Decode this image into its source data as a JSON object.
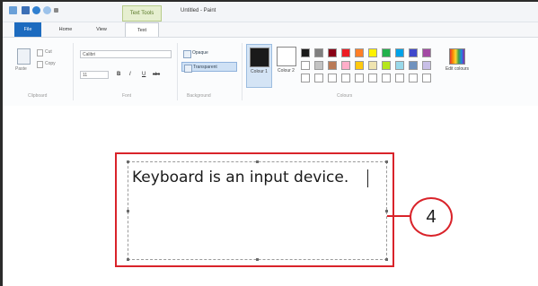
{
  "window": {
    "context_tab_label": "Text Tools",
    "title": "Untitled - Paint"
  },
  "tabs": [
    {
      "label": "File"
    },
    {
      "label": "Home"
    },
    {
      "label": "View"
    },
    {
      "label": "Text"
    }
  ],
  "ribbon": {
    "clipboard": {
      "paste_label": "Paste",
      "cut_label": "Cut",
      "copy_label": "Copy",
      "group_label": "Clipboard"
    },
    "font": {
      "family_value": "Calibri",
      "size_value": "11",
      "bold": "B",
      "italic": "I",
      "underline": "U",
      "strikethrough": "abc",
      "group_label": "Font"
    },
    "background": {
      "opaque_label": "Opaque",
      "transparent_label": "Transparent",
      "group_label": "Background"
    },
    "colors": {
      "color1_label": "Colour 1",
      "color2_label": "Colour 2",
      "edit_label": "Edit colours",
      "group_label": "Colours",
      "color1_value": "#1a1a1a",
      "color2_value": "#ffffff",
      "palette_row1": [
        "#1a1a1a",
        "#7f7f7f",
        "#880015",
        "#ed1c24",
        "#ff7f27",
        "#fff200",
        "#22b14c",
        "#00a2e8",
        "#3f48cc",
        "#a349a4"
      ],
      "palette_row2": [
        "#ffffff",
        "#c3c3c3",
        "#b97a57",
        "#ffaec9",
        "#ffc90e",
        "#efe4b0",
        "#b5e61d",
        "#99d9ea",
        "#7092be",
        "#c8bfe7"
      ],
      "palette_row3": [
        "#ffffff",
        "#ffffff",
        "#ffffff",
        "#ffffff",
        "#ffffff",
        "#ffffff",
        "#ffffff",
        "#ffffff",
        "#ffffff",
        "#ffffff"
      ]
    }
  },
  "canvas": {
    "text": "Keyboard is an input device."
  },
  "callout": {
    "number": "4",
    "accent_color": "#d9232a"
  }
}
